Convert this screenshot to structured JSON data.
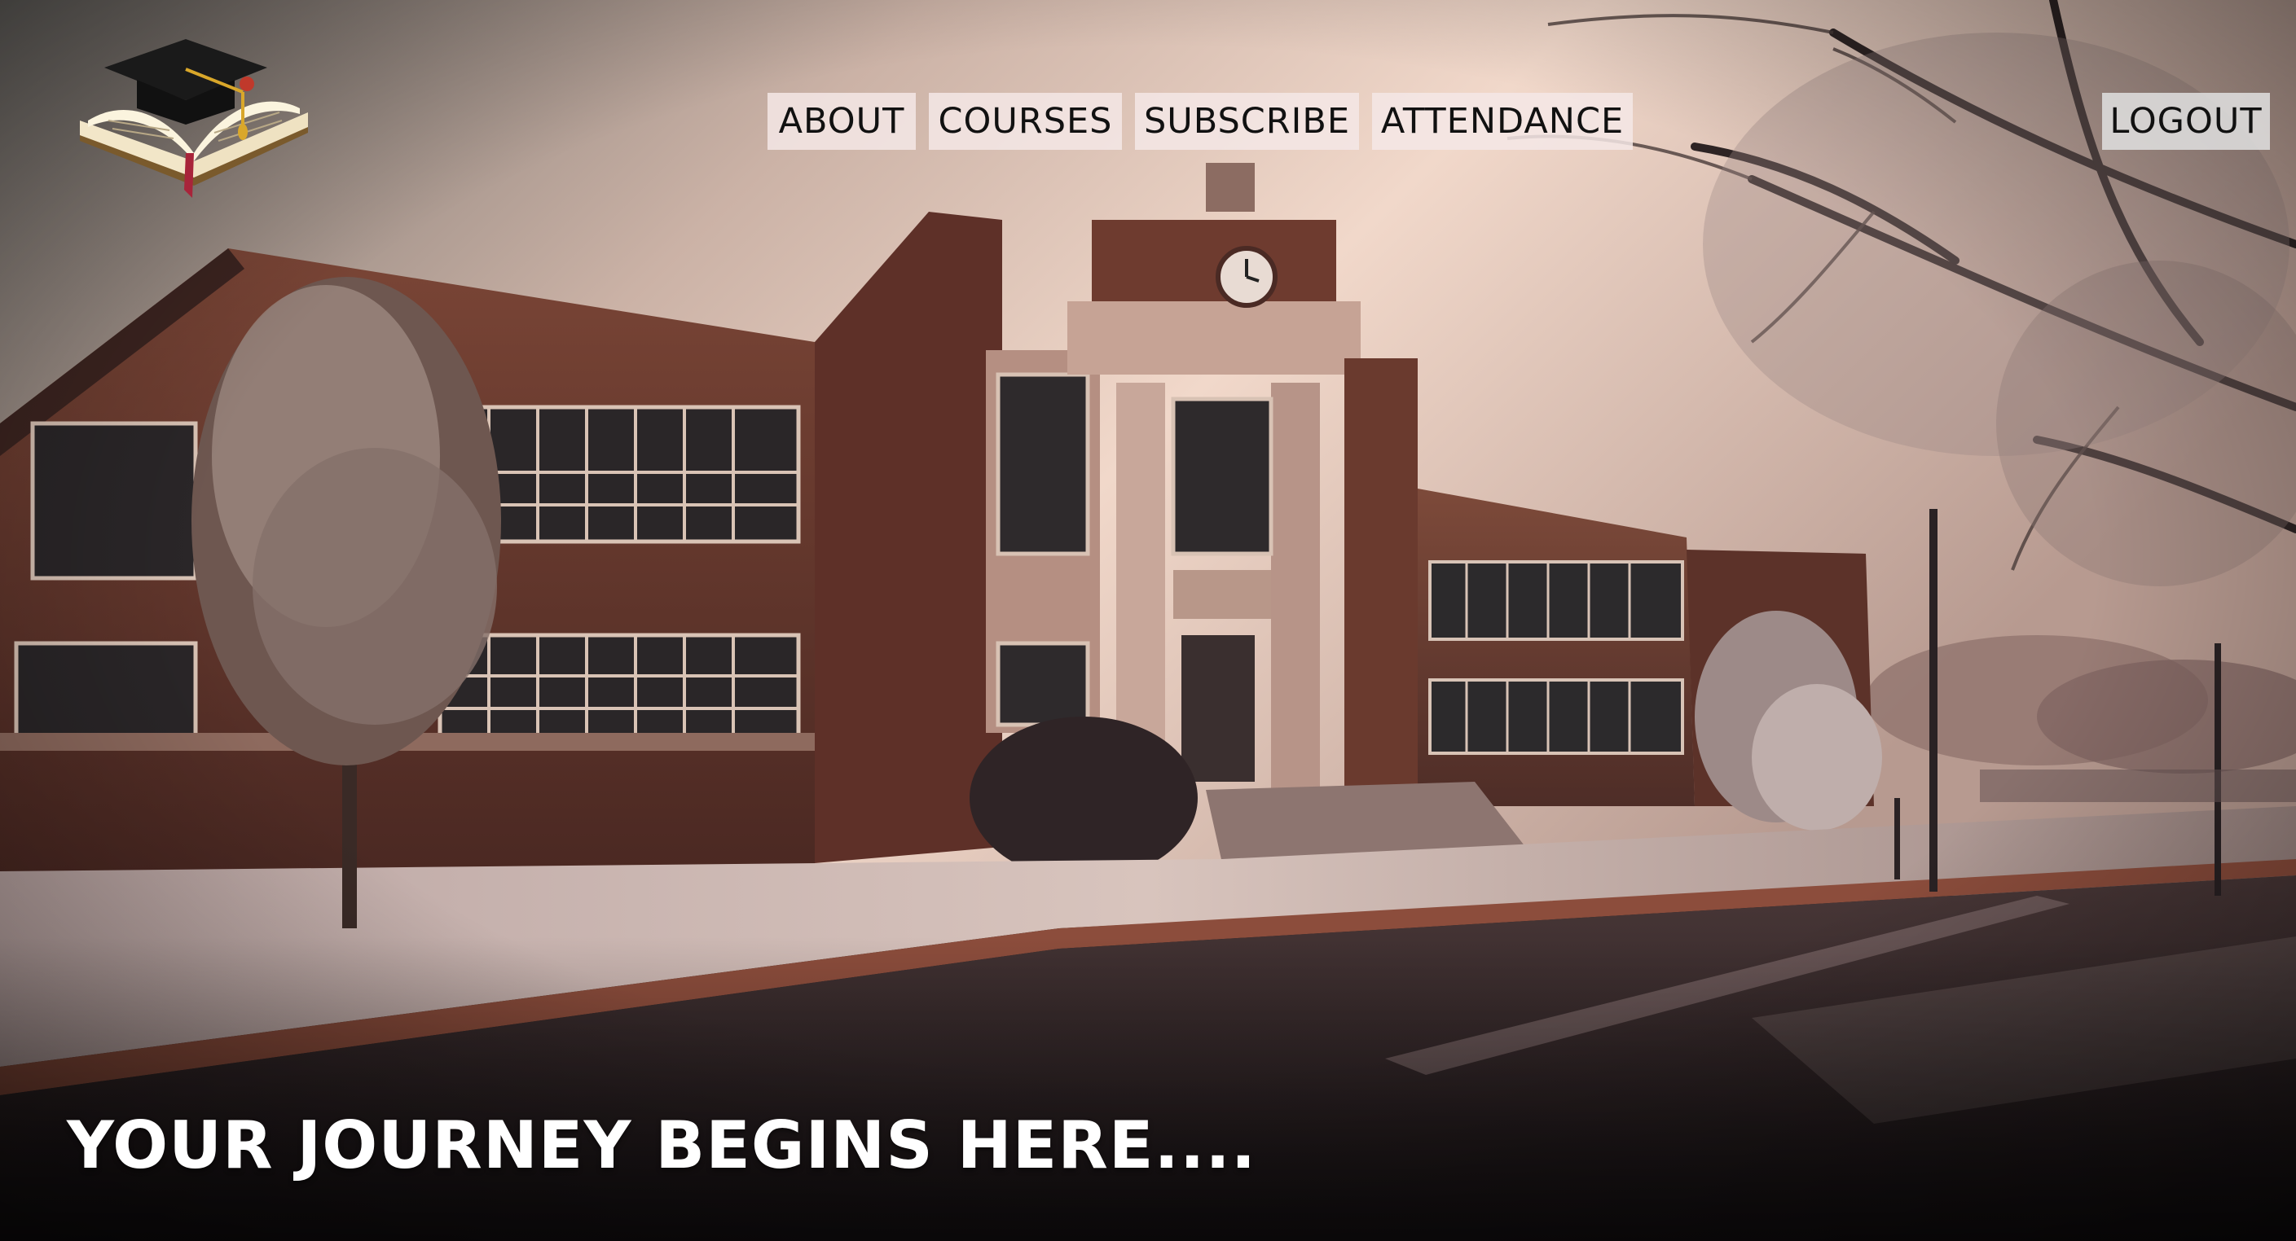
{
  "nav": {
    "items": [
      {
        "label": "ABOUT"
      },
      {
        "label": "COURSES"
      },
      {
        "label": "SUBSCRIBE"
      },
      {
        "label": "ATTENDANCE"
      }
    ],
    "logout_label": "LOGOUT"
  },
  "hero": {
    "tagline": "YOUR JOURNEY BEGINS HERE....",
    "image": "school-building-photo"
  },
  "logo": {
    "icon": "graduation-cap-book-icon"
  },
  "colors": {
    "nav_bg": "#f4e8e6",
    "logout_bg": "#e1e1e1",
    "tagline": "#ffffff",
    "sky": "#e9cdbf",
    "brick": "#6b3a2e"
  }
}
